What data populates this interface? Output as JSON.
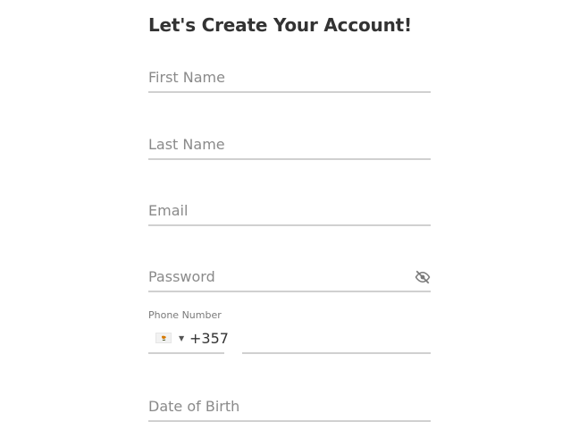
{
  "form": {
    "title": "Let's Create Your Account!",
    "first_name_placeholder": "First Name",
    "last_name_placeholder": "Last Name",
    "email_placeholder": "Email",
    "password_placeholder": "Password",
    "phone_label": "Phone Number",
    "phone_country_code": "+357",
    "phone_country_flag_icon": "cyprus-flag-icon",
    "password_toggle_icon": "eye-off-icon",
    "dob_placeholder": "Date of Birth"
  }
}
